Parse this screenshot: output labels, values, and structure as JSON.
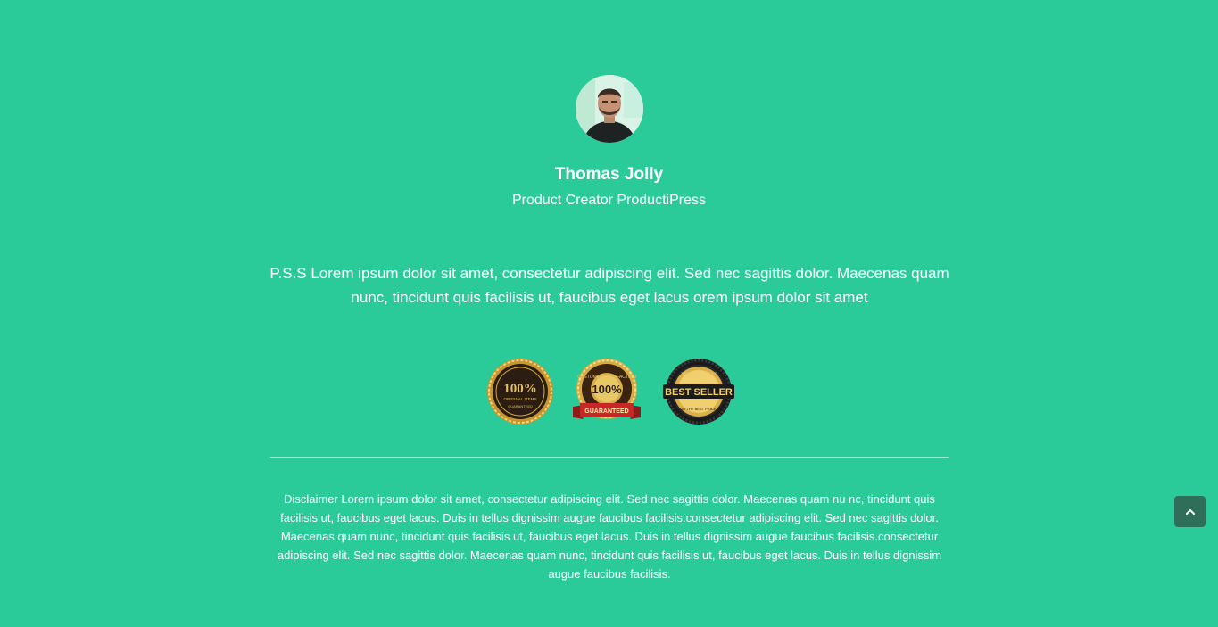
{
  "profile": {
    "name": "Thomas Jolly",
    "role": "Product Creator ProductiPress"
  },
  "pss_text": "P.S.S Lorem ipsum dolor sit amet, consectetur adipiscing elit. Sed nec sagittis dolor. Maecenas quam nunc, tincidunt quis facilisis ut, faucibus eget lacus orem ipsum dolor sit amet",
  "badges": [
    {
      "icon": "original-items-seal-icon",
      "big": "100%",
      "line1": "ORIGINAL ITEMS",
      "line2": "GUARANTEED"
    },
    {
      "icon": "customer-satisfaction-seal-icon",
      "big": "100%",
      "arc": "CUSTOMER SATISFACTION",
      "ribbon": "GUARANTEED"
    },
    {
      "icon": "best-seller-seal-icon",
      "top": "THE BEST PRODUCT",
      "big": "BEST SELLER",
      "bottom": "AT THE BEST PRICE"
    }
  ],
  "disclaimer": "Disclaimer Lorem ipsum dolor sit amet, consectetur adipiscing elit. Sed nec sagittis dolor. Maecenas quam nu nc, tincidunt quis facilisis ut, faucibus eget lacus. Duis in tellus dignissim augue faucibus facilisis.consectetur adipiscing elit. Sed nec sagittis dolor. Maecenas quam nunc, tincidunt quis facilisis ut, faucibus eget lacus. Duis in tellus dignissim augue faucibus facilisis.consectetur adipiscing elit. Sed nec sagittis dolor. Maecenas quam nunc, tincidunt quis facilisis ut, faucibus eget lacus. Duis in tellus dignissim augue faucibus facilisis.",
  "scroll_top": {
    "icon": "chevron-up-icon"
  },
  "colors": {
    "background": "#2acb98",
    "text": "#ffffff",
    "scroll_button": "#2f6f5a",
    "gold": "#d4a93c",
    "dark": "#2b1d12"
  }
}
